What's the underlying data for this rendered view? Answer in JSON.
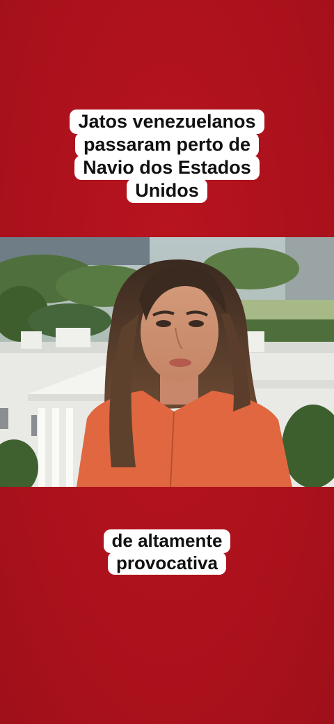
{
  "captions": {
    "top_lines": [
      "Jatos venezuelanos",
      "passaram perto de",
      "Navio dos Estados",
      "Unidos"
    ],
    "bottom_lines": [
      "de altamente",
      "provocativa"
    ]
  },
  "colors": {
    "background": "#b0121d",
    "caption_bg": "#ffffff",
    "caption_text": "#111111",
    "blouse": "#e0673f"
  },
  "video": {
    "scene": "news-frame"
  }
}
